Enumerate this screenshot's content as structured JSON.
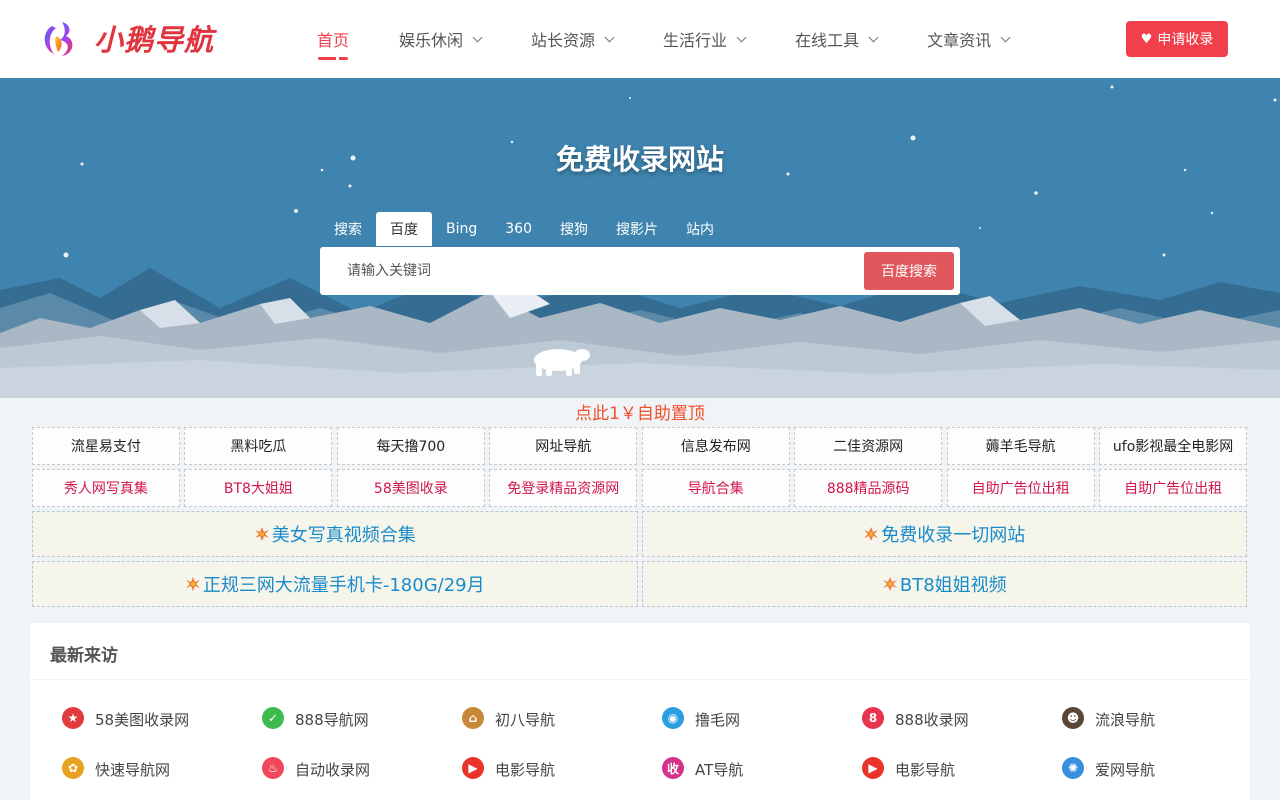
{
  "header": {
    "logo_text": "小鹅导航",
    "nav": [
      {
        "label": "首页",
        "active": true,
        "dropdown": false
      },
      {
        "label": "娱乐休闲",
        "active": false,
        "dropdown": true
      },
      {
        "label": "站长资源",
        "active": false,
        "dropdown": true
      },
      {
        "label": "生活行业",
        "active": false,
        "dropdown": true
      },
      {
        "label": "在线工具",
        "active": false,
        "dropdown": true
      },
      {
        "label": "文章资讯",
        "active": false,
        "dropdown": true
      }
    ],
    "apply_button": "申请收录"
  },
  "hero": {
    "title": "免费收录网站",
    "search_tabs": [
      {
        "label": "搜索",
        "active": false
      },
      {
        "label": "百度",
        "active": true
      },
      {
        "label": "Bing",
        "active": false
      },
      {
        "label": "360",
        "active": false
      },
      {
        "label": "搜狗",
        "active": false
      },
      {
        "label": "搜影片",
        "active": false
      },
      {
        "label": "站内",
        "active": false
      }
    ],
    "search_placeholder": "请输入关键词",
    "search_button": "百度搜索"
  },
  "pin_link": "点此1￥自助置顶",
  "link_grid": {
    "row1": [
      "流星易支付",
      "黑料吃瓜",
      "每天撸700",
      "网址导航",
      "信息发布网",
      "二佳资源网",
      "薅羊毛导航",
      "ufo影视最全电影网"
    ],
    "row2": [
      "秀人网写真集",
      "BT8大姐姐",
      "58美图收录",
      "免登录精品资源网",
      "导航合集",
      "888精品源码",
      "自助广告位出租",
      "自助广告位出租"
    ],
    "wide": [
      "美女写真视频合集",
      "免费收录一切网站",
      "正规三网大流量手机卡-180G/29月",
      "BT8姐姐视频"
    ]
  },
  "recent_visitors": {
    "title": "最新来访",
    "items": [
      {
        "label": "58美图收录网",
        "icon": "star-icon",
        "color": "#e23b3b"
      },
      {
        "label": "888导航网",
        "icon": "check-icon",
        "color": "#3dbb4c"
      },
      {
        "label": "初八导航",
        "icon": "badge-icon",
        "color": "#c8883a"
      },
      {
        "label": "撸毛网",
        "icon": "globe-icon",
        "color": "#2a9ee0"
      },
      {
        "label": "888收录网",
        "icon": "eight-icon",
        "color": "#e8344c"
      },
      {
        "label": "流浪导航",
        "icon": "face-icon",
        "color": "#5a4636"
      },
      {
        "label": "快速导航网",
        "icon": "flower-icon",
        "color": "#e8a21e"
      },
      {
        "label": "自动收录网",
        "icon": "flame-icon",
        "color": "#f0485a"
      },
      {
        "label": "电影导航",
        "icon": "play-icon",
        "color": "#e8342a"
      },
      {
        "label": "AT导航",
        "icon": "collect-icon",
        "color": "#d5338a"
      },
      {
        "label": "电影导航",
        "icon": "play-icon",
        "color": "#e8342a"
      },
      {
        "label": "爱网导航",
        "icon": "pinwheel-icon",
        "color": "#3a8fe0"
      }
    ]
  },
  "colors": {
    "accent": "#f1404b",
    "hero_bg": "#3e84ae",
    "link_blue": "#1a8bc9",
    "pink_text": "#d1174c",
    "pin_orange": "#f1502a"
  }
}
